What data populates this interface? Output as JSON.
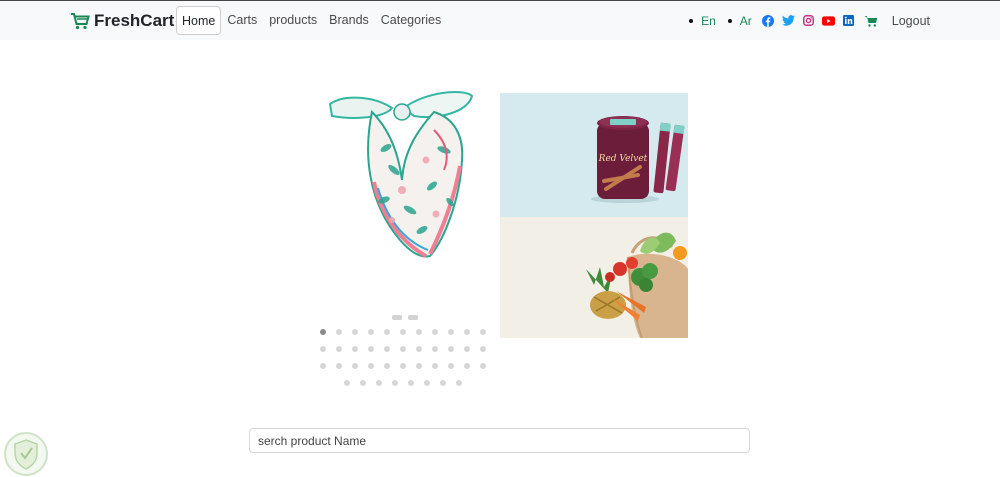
{
  "navbar": {
    "brand": "FreshCart",
    "links": [
      {
        "label": "Home",
        "active": true
      },
      {
        "label": "Carts",
        "active": false
      },
      {
        "label": "products",
        "active": false
      },
      {
        "label": "Brands",
        "active": false
      },
      {
        "label": "Categories",
        "active": false
      }
    ],
    "languages": [
      "En",
      "Ar"
    ],
    "social_icons": [
      "facebook-icon",
      "twitter-icon",
      "instagram-icon",
      "youtube-icon",
      "linkedin-icon"
    ],
    "cart_icon": "cart-icon",
    "logout_label": "Logout"
  },
  "slider": {
    "main_image": "scarf-product",
    "side_images": [
      "red-velvet-wafer-rolls",
      "grocery-bag-vegetables"
    ],
    "wafer_brand_small": "Red Velvet",
    "dot_count": 41,
    "active_dot": 0
  },
  "search": {
    "placeholder": "serch product Name",
    "value": ""
  },
  "colors": {
    "brand_green": "#198754",
    "facebook": "#1877f2",
    "twitter": "#1da1f2",
    "instagram": "#c13584",
    "youtube": "#ff0000",
    "linkedin": "#0a66c2"
  }
}
